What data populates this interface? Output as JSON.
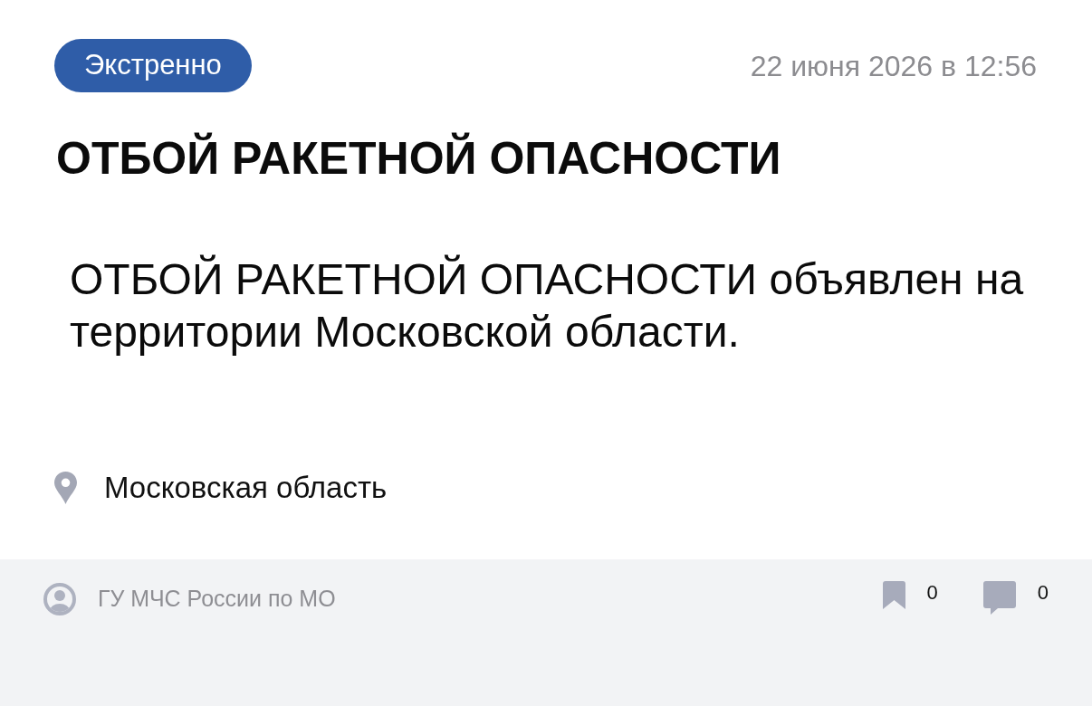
{
  "badge": {
    "label": "Экстренно"
  },
  "date": "22 июня 2026 в 12:56",
  "title": "ОТБОЙ РАКЕТНОЙ ОПАСНОСТИ",
  "body": "ОТБОЙ РАКЕТНОЙ ОПАСНОСТИ объявлен на территории Московской области.",
  "location": "Московская область",
  "footer": {
    "source": "ГУ МЧС России по МО",
    "counters": [
      {
        "kind": "bookmark",
        "count": "0"
      },
      {
        "kind": "comment",
        "count": "0"
      }
    ]
  }
}
